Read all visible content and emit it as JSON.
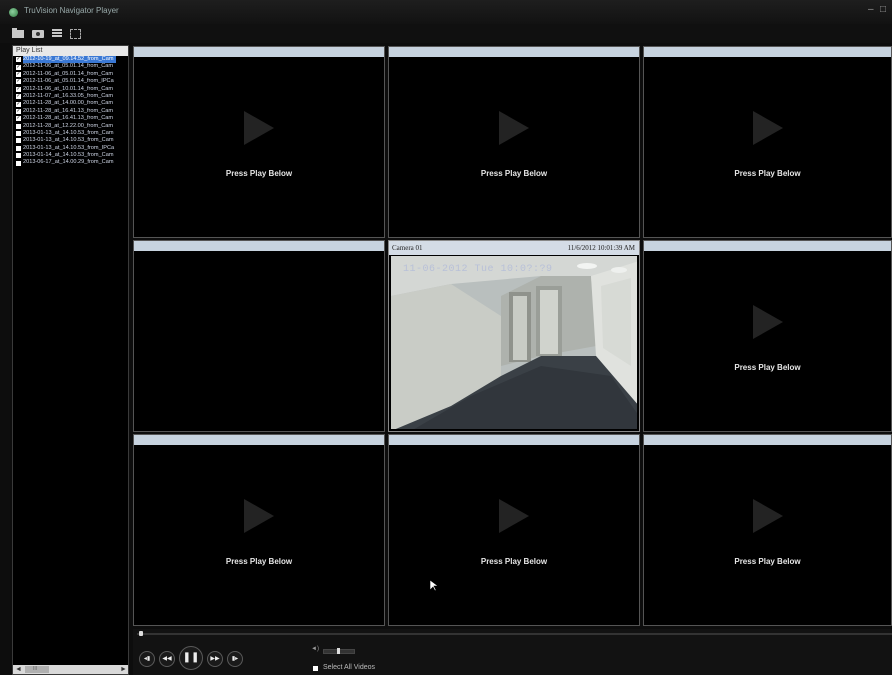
{
  "window": {
    "title": "TruVision Navigator Player",
    "minimize": "–",
    "restore": "□"
  },
  "toolbar": {
    "icons": [
      "folder-icon",
      "camera-icon",
      "list-icon",
      "fullscreen-icon"
    ]
  },
  "playlist": {
    "header": "Play List",
    "items": [
      {
        "label": "2012-10-19_at_09.14.52_from_Cam",
        "checked": true,
        "selected": true
      },
      {
        "label": "2012-11-06_at_05.01.14_from_Cam",
        "checked": true
      },
      {
        "label": "2012-11-06_at_05.01.14_from_Cam",
        "checked": true
      },
      {
        "label": "2012-11-06_at_05.01.14_from_IPCa",
        "checked": true
      },
      {
        "label": "2012-11-06_at_10.01.14_from_Cam",
        "checked": true
      },
      {
        "label": "2012-11-07_at_16.33.05_from_Cam",
        "checked": true
      },
      {
        "label": "2012-11-28_at_14.00.00_from_Cam",
        "checked": true
      },
      {
        "label": "2012-11-28_at_16.41.13_from_Cam",
        "checked": true
      },
      {
        "label": "2012-11-28_at_16.41.13_from_Cam",
        "checked": true
      },
      {
        "label": "2012-11-28_at_12.22.00_from_Cam",
        "checked": false
      },
      {
        "label": "2013-01-13_at_14.10.53_from_Cam",
        "checked": false
      },
      {
        "label": "2013-01-13_at_14.10.53_from_Cam",
        "checked": false
      },
      {
        "label": "2013-01-13_at_14.10.53_from_IPCa",
        "checked": false
      },
      {
        "label": "2013-01-14_at_14.10.53_from_Cam",
        "checked": false
      },
      {
        "label": "2013-06-17_at_14.00.29_from_Cam",
        "checked": false
      }
    ],
    "scroll_left": "◄",
    "scroll_right": "►",
    "scroll_thumb": "III"
  },
  "tiles": [
    {
      "id": 1,
      "text": "Press Play Below"
    },
    {
      "id": 2,
      "text": "Press Play Below"
    },
    {
      "id": 3,
      "text": "Press Play Below"
    },
    {
      "id": 4,
      "text": ""
    },
    {
      "id": 5,
      "camera": "Camera 01",
      "timestamp": "11/6/2012 10:01:39 AM",
      "osd": "11-06-2012 Tue 10:0?:?9"
    },
    {
      "id": 6,
      "text": "Press Play Below"
    },
    {
      "id": 7,
      "text": "Press Play Below"
    },
    {
      "id": 8,
      "text": "Press Play Below"
    },
    {
      "id": 9,
      "text": "Press Play Below"
    }
  ],
  "controls": {
    "buttons": [
      {
        "name": "prev-frame-button",
        "glyph": "◂▮"
      },
      {
        "name": "rewind-button",
        "glyph": "◀◀"
      },
      {
        "name": "pause-button",
        "glyph": "❚❚"
      },
      {
        "name": "fast-forward-button",
        "glyph": "▶▶"
      },
      {
        "name": "next-frame-button",
        "glyph": "▮▸"
      }
    ],
    "volume_icon": "◄)",
    "select_all": "Select All Videos"
  }
}
